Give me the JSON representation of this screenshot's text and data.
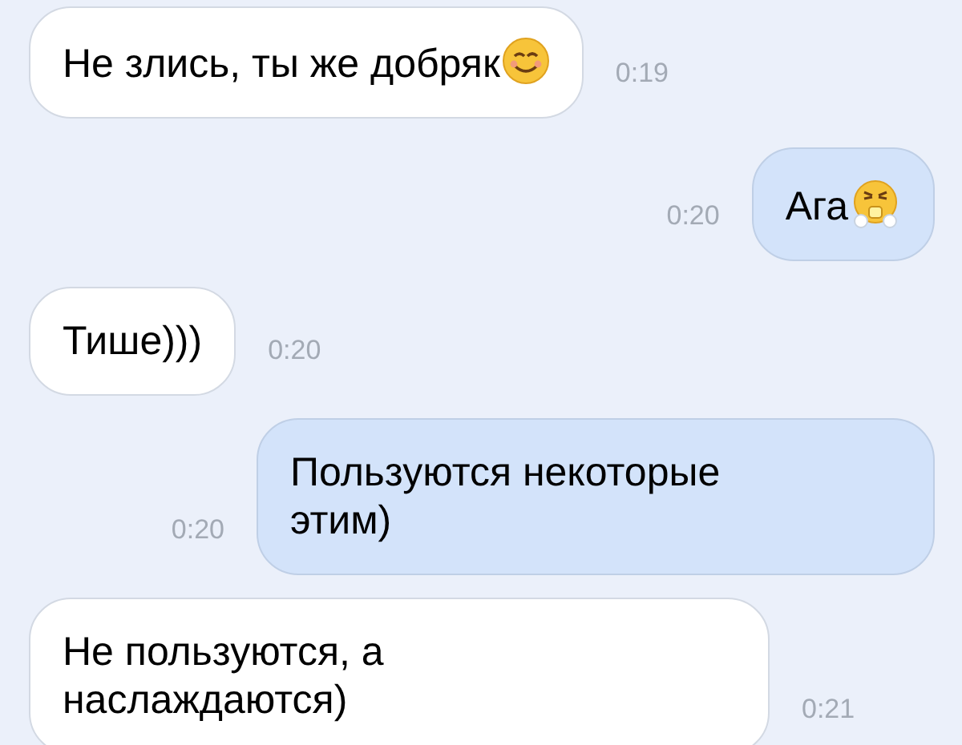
{
  "messages": [
    {
      "kind": "incoming",
      "parts": [
        {
          "kind": "text",
          "text": "Не злись, ты же добряк"
        },
        {
          "kind": "smile"
        }
      ],
      "time": "0:19"
    },
    {
      "kind": "outgoing",
      "parts": [
        {
          "kind": "text",
          "text": "Ага"
        },
        {
          "kind": "huff"
        }
      ],
      "time": "0:20"
    },
    {
      "kind": "incoming",
      "parts": [
        {
          "kind": "text",
          "text": "Тише)))"
        }
      ],
      "time": "0:20"
    },
    {
      "kind": "outgoing",
      "parts": [
        {
          "kind": "text",
          "text": "Пользуются некоторые этим)"
        }
      ],
      "time": "0:20"
    },
    {
      "kind": "incoming",
      "parts": [
        {
          "kind": "text",
          "text": "Не пользуются, а наслаждаются)"
        }
      ],
      "time": "0:21"
    }
  ]
}
